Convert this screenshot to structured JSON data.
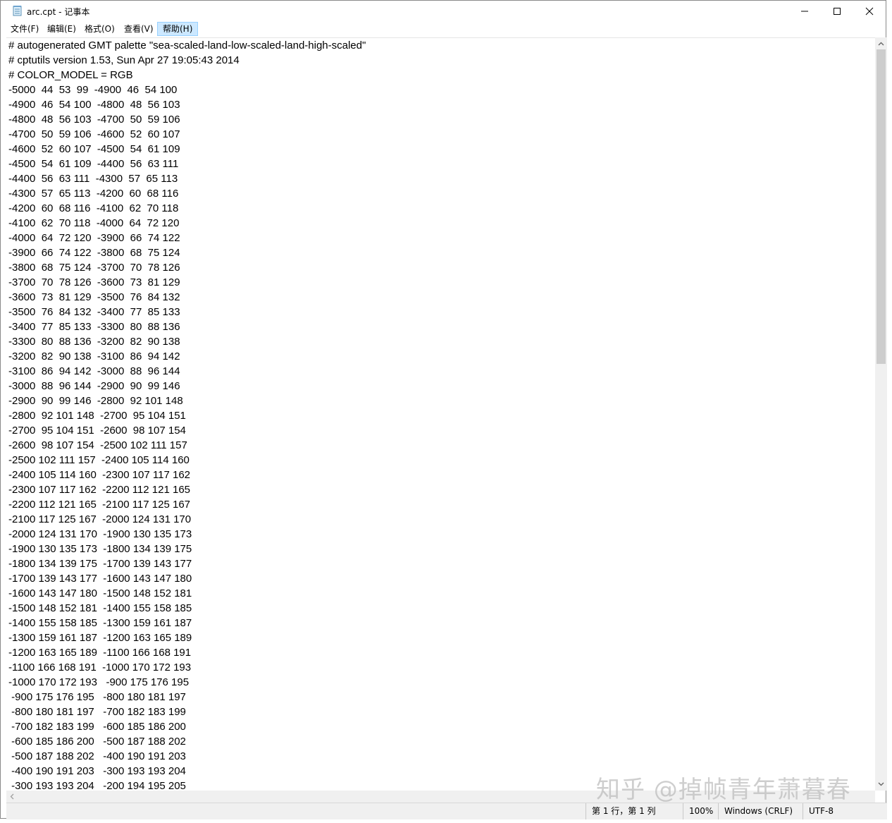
{
  "window": {
    "title": "arc.cpt - 记事本"
  },
  "menu": [
    {
      "label": "文件(F)"
    },
    {
      "label": "编辑(E)"
    },
    {
      "label": "格式(O)"
    },
    {
      "label": "查看(V)"
    },
    {
      "label": "帮助(H)"
    }
  ],
  "lines": [
    "# autogenerated GMT palette \"sea-scaled-land-low-scaled-land-high-scaled\"",
    "# cptutils version 1.53, Sun Apr 27 19:05:43 2014",
    "# COLOR_MODEL = RGB",
    "-5000  44  53  99  -4900  46  54 100",
    "-4900  46  54 100  -4800  48  56 103",
    "-4800  48  56 103  -4700  50  59 106",
    "-4700  50  59 106  -4600  52  60 107",
    "-4600  52  60 107  -4500  54  61 109",
    "-4500  54  61 109  -4400  56  63 111",
    "-4400  56  63 111  -4300  57  65 113",
    "-4300  57  65 113  -4200  60  68 116",
    "-4200  60  68 116  -4100  62  70 118",
    "-4100  62  70 118  -4000  64  72 120",
    "-4000  64  72 120  -3900  66  74 122",
    "-3900  66  74 122  -3800  68  75 124",
    "-3800  68  75 124  -3700  70  78 126",
    "-3700  70  78 126  -3600  73  81 129",
    "-3600  73  81 129  -3500  76  84 132",
    "-3500  76  84 132  -3400  77  85 133",
    "-3400  77  85 133  -3300  80  88 136",
    "-3300  80  88 136  -3200  82  90 138",
    "-3200  82  90 138  -3100  86  94 142",
    "-3100  86  94 142  -3000  88  96 144",
    "-3000  88  96 144  -2900  90  99 146",
    "-2900  90  99 146  -2800  92 101 148",
    "-2800  92 101 148  -2700  95 104 151",
    "-2700  95 104 151  -2600  98 107 154",
    "-2600  98 107 154  -2500 102 111 157",
    "-2500 102 111 157  -2400 105 114 160",
    "-2400 105 114 160  -2300 107 117 162",
    "-2300 107 117 162  -2200 112 121 165",
    "-2200 112 121 165  -2100 117 125 167",
    "-2100 117 125 167  -2000 124 131 170",
    "-2000 124 131 170  -1900 130 135 173",
    "-1900 130 135 173  -1800 134 139 175",
    "-1800 134 139 175  -1700 139 143 177",
    "-1700 139 143 177  -1600 143 147 180",
    "-1600 143 147 180  -1500 148 152 181",
    "-1500 148 152 181  -1400 155 158 185",
    "-1400 155 158 185  -1300 159 161 187",
    "-1300 159 161 187  -1200 163 165 189",
    "-1200 163 165 189  -1100 166 168 191",
    "-1100 166 168 191  -1000 170 172 193",
    "-1000 170 172 193   -900 175 176 195",
    " -900 175 176 195   -800 180 181 197",
    " -800 180 181 197   -700 182 183 199",
    " -700 182 183 199   -600 185 186 200",
    " -600 185 186 200   -500 187 188 202",
    " -500 187 188 202   -400 190 191 203",
    " -400 190 191 203   -300 193 193 204",
    " -300 193 193 204   -200 194 195 205"
  ],
  "status": {
    "position": "第 1 行，第 1 列",
    "zoom": "100%",
    "line_ending": "Windows (CRLF)",
    "encoding": "UTF-8"
  },
  "watermark": "知乎 @掉帧青年萧暮春",
  "icons": {
    "app": "notepad-icon",
    "minimize": "minimize-icon",
    "maximize": "maximize-icon",
    "close": "close-icon"
  }
}
